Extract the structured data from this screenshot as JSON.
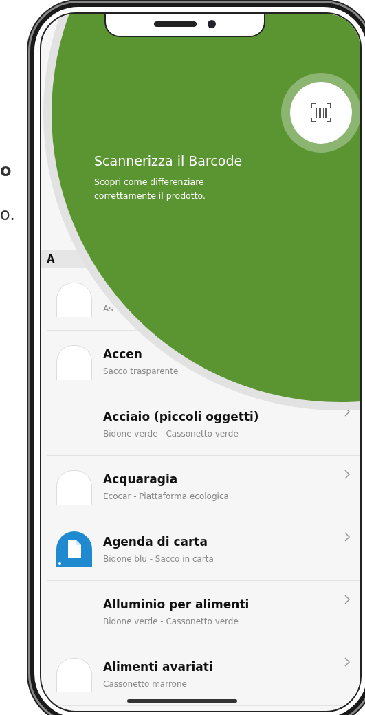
{
  "background_text": [
    "o",
    "o."
  ],
  "section": {
    "letter": "A"
  },
  "items": [
    {
      "subtitle": "As",
      "kind": "blank"
    },
    {
      "title": "Accen",
      "subtitle": "Sacco trasparente",
      "kind": "blank"
    },
    {
      "title": "Acciaio (piccoli oggetti)",
      "subtitle": "Bidone verde - Cassonetto verde",
      "kind": "none"
    },
    {
      "title": "Acquaragia",
      "subtitle": "Ecocar - Piattaforma ecologica",
      "kind": "blank"
    },
    {
      "title": "Agenda di carta",
      "subtitle": "Bidone blu - Sacco in carta",
      "kind": "paper",
      "color": "#1f8ad0"
    },
    {
      "title": "Alluminio per alimenti",
      "subtitle": "Bidone verde - Cassonetto verde",
      "kind": "none"
    },
    {
      "title": "Alimenti avariati",
      "subtitle": "Cassonetto marrone",
      "kind": "blank"
    }
  ],
  "coach_mark": {
    "title": "Scannerizza il Barcode",
    "text": "Scopri come differenziare correttamente il prodotto."
  }
}
